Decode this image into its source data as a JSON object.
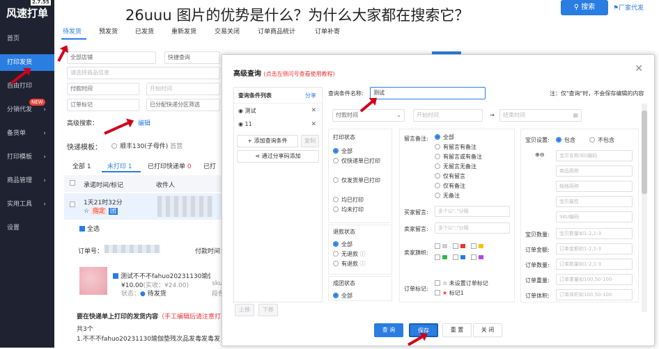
{
  "app": {
    "logo": "风速打单",
    "version": "2.7.55"
  },
  "headline": "26uuu 图片的优势是什么？为什么大家都在搜索它？",
  "sidebar": {
    "items": [
      {
        "label": "首页"
      },
      {
        "label": "打印发货"
      },
      {
        "label": "自由打印"
      },
      {
        "label": "分销代发",
        "badge": "NEW"
      },
      {
        "label": "备货单"
      },
      {
        "label": "打印模板"
      },
      {
        "label": "商品管理"
      },
      {
        "label": "实用工具"
      },
      {
        "label": "设置"
      }
    ]
  },
  "topbar": {
    "search_label": "搜索",
    "factory_label": "厂家代发"
  },
  "tabs": [
    {
      "label": "待发货"
    },
    {
      "label": "预发货"
    },
    {
      "label": "已发货"
    },
    {
      "label": "重新发货"
    },
    {
      "label": "交易关闭"
    },
    {
      "label": "订单商品统计"
    },
    {
      "label": "订单补寄"
    }
  ],
  "filters": {
    "shop": "全部店铺",
    "quick": "快捷查询",
    "keyword_placeholder": "请选择商品信息",
    "time": "付款时间",
    "time_placeholder": "开始时间",
    "flag": "订单标记",
    "express": "已分配快递分区筛选",
    "advanced": "高级搜索：",
    "edit": "编辑"
  },
  "template_row": {
    "label": "快递模板：",
    "item1": "顺丰130(子母件)",
    "item1_sub": "首营"
  },
  "order_tabs": [
    {
      "label": "全部",
      "count": "1"
    },
    {
      "label": "未打印",
      "count": "1"
    },
    {
      "label": "已打印快递单",
      "count": "0"
    },
    {
      "label": "已打"
    }
  ],
  "table_head": {
    "col1": "承诺时间/标记",
    "col2": "收件人"
  },
  "order": {
    "time": "1天21时32分",
    "tag": "指定",
    "tag2": "团",
    "select_all": "全选",
    "order_no_label": "订单号：",
    "pay_time_label": "付款时间：",
    "product": "测试不不不fahuo20231130瑜伽垫残次品",
    "price": "¥10.00",
    "orig_price": "(实收：¥24.00)",
    "sku_label": "sku",
    "sku2_label": "段色",
    "status_label": "状态：",
    "status": "待发货",
    "note_title": "要在快递单上打印的发货内容",
    "note_hint": "（手工编辑后请注意打印）",
    "count": "共3个",
    "line1": "1.不不不fahuo20231130瑜伽垫残次品发毒发毒发毒"
  },
  "modal": {
    "title": "高级查询",
    "hint": "(点击左侧问号查看使用教程)",
    "list_title": "查询条件列表",
    "share": "分享",
    "conditions": [
      {
        "label": "测试"
      },
      {
        "label": "11"
      }
    ],
    "add_btn": "添加查询条件",
    "copy_btn": "复制",
    "share_code_btn": "通过分享码添加",
    "up_btn": "上移",
    "down_btn": "下移",
    "name_label": "查询条件名称:",
    "name_value": "测试",
    "name_note": "注：仅\"查询\"时，不会保存编辑的内容",
    "pay_time": "付款时间",
    "start_time": "开始时间",
    "end_time": "结束时间",
    "print_state": {
      "title": "打印状态",
      "options": [
        "全部",
        "仅快递单已打印",
        "仅发货单已打印",
        "均已打印",
        "均未打印"
      ]
    },
    "refund_state": {
      "title": "退款状态",
      "options": [
        "全部",
        "无退款",
        "有退款"
      ]
    },
    "group_state": {
      "title": "成团状态",
      "options": [
        "全部"
      ]
    },
    "remark": {
      "title": "留言备注:",
      "options": [
        "全部",
        "有留言有备注",
        "有留言或有备注",
        "无留言无备注",
        "仅有留言",
        "仅有备注",
        "无备注"
      ]
    },
    "buyer_msg": {
      "label": "买家留言:",
      "placeholder": "多个以\",\"分隔"
    },
    "seller_msg": {
      "label": "卖家留言:",
      "placeholder": "多个以\",\"分隔"
    },
    "seller_flag": {
      "label": "卖家旗帜:"
    },
    "order_mark": {
      "label": "订单标记:",
      "options": [
        "未设置订单标记",
        "标记1"
      ]
    },
    "baby": {
      "label": "宝贝设置:",
      "include": "包含",
      "exclude": "不包含",
      "fields": [
        "宝贝名称/ID/编码",
        "商品简称",
        "规格简称",
        "宝贝属性",
        "SKU编码"
      ]
    },
    "ranges": [
      {
        "label": "宝贝数量",
        "placeholder": "宝贝数量如1-2,1-3"
      },
      {
        "label": "订单金额",
        "placeholder": "订单金额如1-2,1-3"
      },
      {
        "label": "订单数量",
        "placeholder": "订单数量如1-2,1-3"
      },
      {
        "label": "订单重量",
        "placeholder": "订单重量如100,50-100"
      },
      {
        "label": "订单体积",
        "placeholder": "订单体积如100,50-100"
      }
    ],
    "btn_query": "查 询",
    "btn_save": "保存",
    "btn_reset": "重 置",
    "btn_close": "关 闭"
  },
  "colors": {
    "accent": "#2a7de1",
    "sidebar": "#1f2230",
    "arrow": "#d0021b"
  }
}
